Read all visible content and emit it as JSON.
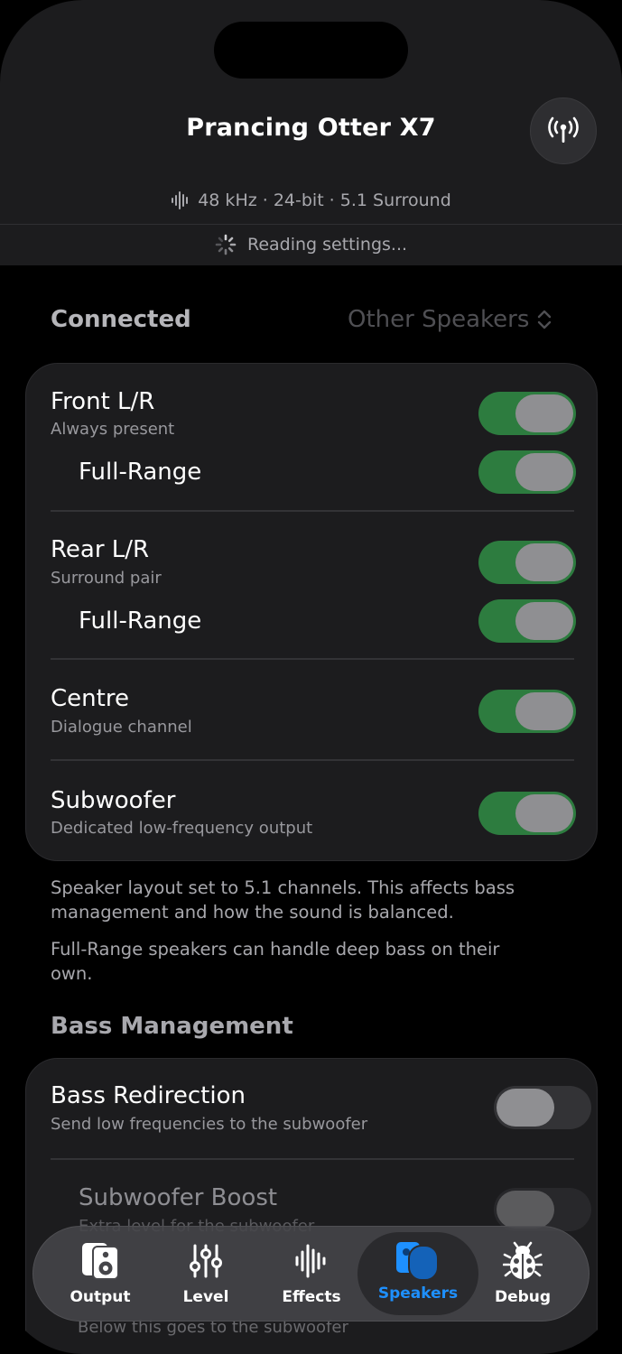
{
  "header": {
    "device_name": "Prancing Otter X7",
    "format": "48 kHz · 24-bit · 5.1 Surround",
    "status": "Reading settings..."
  },
  "speakers": {
    "segment_label": "Connected",
    "picker_label": "Other Speakers",
    "rows": [
      {
        "title": "Front L/R",
        "subtitle": "Always present",
        "on": true
      },
      {
        "title": "Full-Range",
        "on": true
      },
      {
        "title": "Rear L/R",
        "subtitle": "Surround pair",
        "on": true
      },
      {
        "title": "Full-Range",
        "on": true
      },
      {
        "title": "Centre",
        "subtitle": "Dialogue channel",
        "on": true
      },
      {
        "title": "Subwoofer",
        "subtitle": "Dedicated low-frequency output",
        "on": true
      }
    ],
    "footnote1": "Speaker layout set to 5.1 channels. This affects bass management and how the sound is balanced.",
    "footnote2": "Full-Range speakers can handle deep bass on their own."
  },
  "bass": {
    "section_title": "Bass Management",
    "redirection_title": "Bass Redirection",
    "redirection_subtitle": "Send low frequencies to the subwoofer",
    "boost_title": "Subwoofer Boost",
    "boost_subtitle": "Extra level for the subwoofer",
    "below_note": "Below this goes to the subwoofer"
  },
  "tabs": [
    {
      "label": "Output",
      "icon": "speaker-icon"
    },
    {
      "label": "Level",
      "icon": "sliders-icon"
    },
    {
      "label": "Effects",
      "icon": "waveform-icon"
    },
    {
      "label": "Speakers",
      "icon": "speakers-icon",
      "active": true
    },
    {
      "label": "Debug",
      "icon": "ladybug-icon"
    }
  ],
  "colors": {
    "toggle_on": "#2d7c3f",
    "accent": "#1e90ff",
    "background": "#000000",
    "card": "#1c1c1e"
  }
}
